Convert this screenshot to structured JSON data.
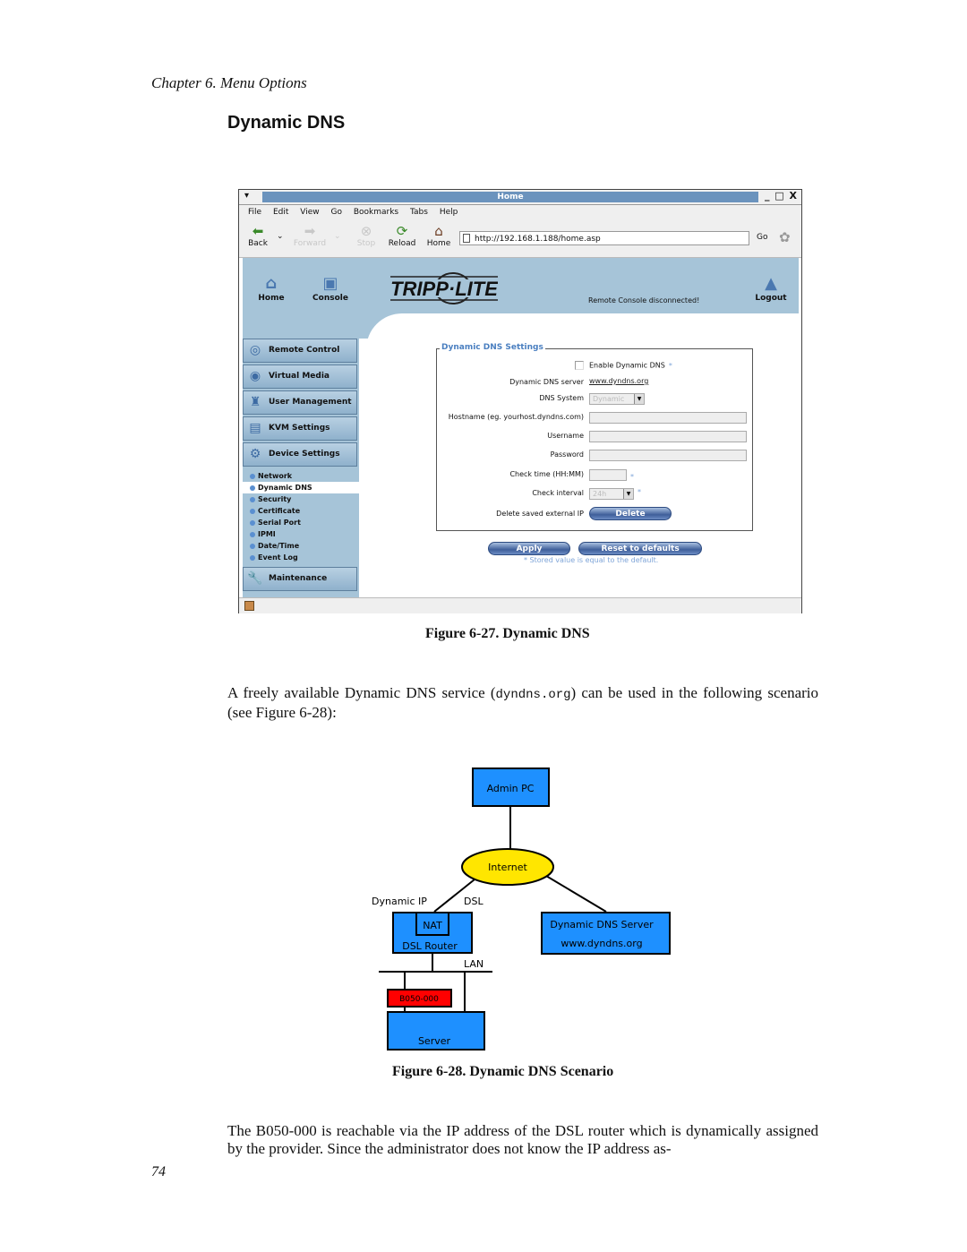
{
  "page": {
    "chapter_header": "Chapter 6. Menu Options",
    "section_title": "Dynamic DNS",
    "figure1_caption": "Figure 6-27. Dynamic DNS",
    "para1_before": "A freely available Dynamic DNS service (",
    "para1_code": "dyndns.org",
    "para1_after": ") can be used in the following scenario (see Figure 6-28):",
    "figure2_caption": "Figure 6-28. Dynamic DNS Scenario",
    "para2": "The B050-000 is reachable via the IP address of the DSL router which is dynamically assigned by the provider. Since the administrator does not know the IP address as-",
    "page_number": "74"
  },
  "browser": {
    "window_title": "Home",
    "window_controls": "_ □ X",
    "menu": [
      "File",
      "Edit",
      "View",
      "Go",
      "Bookmarks",
      "Tabs",
      "Help"
    ],
    "toolbar": {
      "back": "Back",
      "forward": "Forward",
      "stop": "Stop",
      "reload": "Reload",
      "home": "Home",
      "url": "http://192.168.1.188/home.asp",
      "go": "Go"
    }
  },
  "app": {
    "header": {
      "home": "Home",
      "console": "Console",
      "logo": "TRIPP·LITE",
      "status": "Remote Console disconnected!",
      "logout": "Logout"
    },
    "sidebar": {
      "items": [
        {
          "label": "Remote Control",
          "icon": "remote-control-icon"
        },
        {
          "label": "Virtual Media",
          "icon": "virtual-media-icon"
        },
        {
          "label": "User Management",
          "icon": "users-icon"
        },
        {
          "label": "KVM Settings",
          "icon": "kvm-icon"
        },
        {
          "label": "Device Settings",
          "icon": "gears-icon"
        }
      ],
      "subitems": [
        "Network",
        "Dynamic DNS",
        "Security",
        "Certificate",
        "Serial Port",
        "IPMI",
        "Date/Time",
        "Event Log"
      ],
      "active_subitem": "Dynamic DNS",
      "maintenance": "Maintenance"
    },
    "form": {
      "legend": "Dynamic DNS Settings",
      "enable_label": "Enable Dynamic DNS",
      "enable_checked": false,
      "server_label": "Dynamic DNS server",
      "server_link": "www.dyndns.org",
      "system_label": "DNS System",
      "system_value": "Dynamic",
      "hostname_label": "Hostname (eg. yourhost.dyndns.com)",
      "hostname_value": "",
      "username_label": "Username",
      "username_value": "",
      "password_label": "Password",
      "password_value": "",
      "checktime_label": "Check time (HH:MM)",
      "checktime_value": "",
      "interval_label": "Check interval",
      "interval_value": "24h",
      "delete_label": "Delete saved external IP",
      "delete_button": "Delete",
      "star": "*",
      "apply_button": "Apply",
      "reset_button": "Reset to defaults",
      "note": "* Stored value is equal to the default."
    }
  },
  "diagram": {
    "admin_pc": "Admin PC",
    "internet": "Internet",
    "dynamic_ip": "Dynamic IP",
    "dsl": "DSL",
    "nat": "NAT",
    "dsl_router": "DSL Router",
    "dns_server": "Dynamic DNS Server",
    "dns_url": "www.dyndns.org",
    "lan": "LAN",
    "device": "B050-000",
    "server": "Server",
    "colors": {
      "box": "#1e90ff",
      "internet": "#ffe600",
      "device": "#ff0000"
    }
  }
}
